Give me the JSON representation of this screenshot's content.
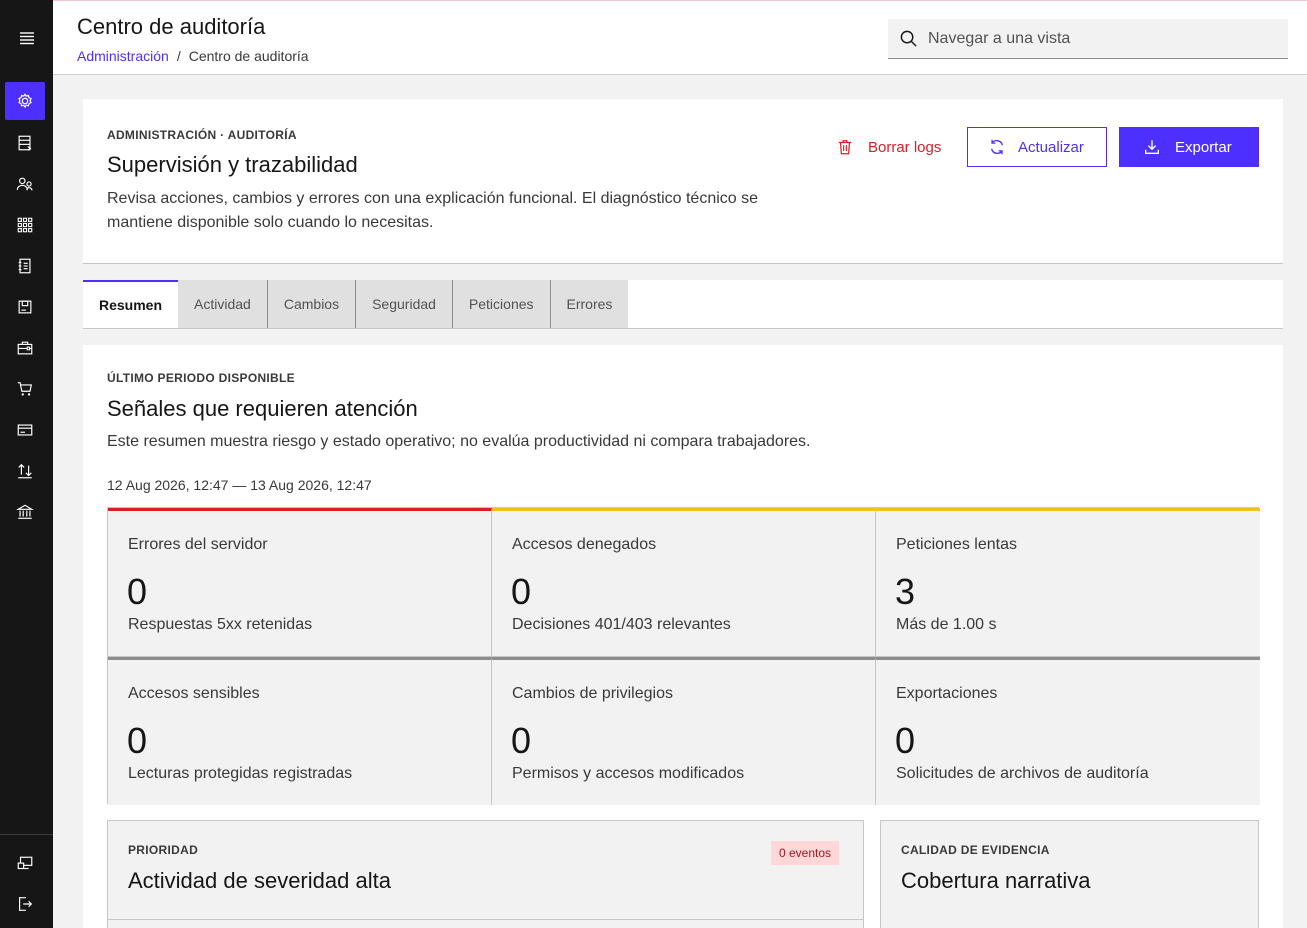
{
  "header": {
    "title": "Centro de auditoría",
    "breadcrumb": {
      "parent": "Administración",
      "separator": "/",
      "current": "Centro de auditoría"
    },
    "search_placeholder": "Navegar a una vista"
  },
  "sidebar": {
    "items": [
      {
        "name": "settings",
        "icon": "gear-icon",
        "active": true
      },
      {
        "name": "data-catalog",
        "icon": "data-icon"
      },
      {
        "name": "users",
        "icon": "user-group-icon"
      },
      {
        "name": "apps",
        "icon": "grid-icon"
      },
      {
        "name": "ledger",
        "icon": "notebook-icon"
      },
      {
        "name": "inventory",
        "icon": "box-icon"
      },
      {
        "name": "business",
        "icon": "briefcase-icon"
      },
      {
        "name": "cart",
        "icon": "cart-icon"
      },
      {
        "name": "payments",
        "icon": "credit-card-icon"
      },
      {
        "name": "transfers",
        "icon": "arrows-icon"
      },
      {
        "name": "bank",
        "icon": "bank-icon"
      }
    ],
    "bottom": [
      {
        "name": "switch-view",
        "icon": "screen-icon"
      },
      {
        "name": "logout",
        "icon": "logout-icon"
      }
    ]
  },
  "intro": {
    "eyebrow": "ADMINISTRACIÓN · AUDITORÍA",
    "title": "Supervisión y trazabilidad",
    "description": "Revisa acciones, cambios y errores con una explicación funcional. El diagnóstico técnico se mantiene disponible solo cuando lo necesitas.",
    "actions": {
      "clear": "Borrar logs",
      "refresh": "Actualizar",
      "export": "Exportar"
    }
  },
  "tabs": [
    "Resumen",
    "Actividad",
    "Cambios",
    "Seguridad",
    "Peticiones",
    "Errores"
  ],
  "summary": {
    "eyebrow": "ÚLTIMO PERIODO DISPONIBLE",
    "title": "Señales que requieren atención",
    "description": "Este resumen muestra riesgo y estado operativo; no evalúa productividad ni compara trabajadores.",
    "range": "12 Aug 2026, 12:47 — 13 Aug 2026, 12:47",
    "metrics": [
      {
        "label": "Errores del servidor",
        "value": "0",
        "sub": "Respuestas 5xx retenidas",
        "accent": "#da1e28"
      },
      {
        "label": "Accesos denegados",
        "value": "0",
        "sub": "Decisiones 401/403 relevantes",
        "accent": "#f1c21b"
      },
      {
        "label": "Peticiones lentas",
        "value": "3",
        "sub": "Más de 1.00 s",
        "accent": "#f1c21b"
      },
      {
        "label": "Accesos sensibles",
        "value": "0",
        "sub": "Lecturas protegidas registradas",
        "accent": "#8d8d8d"
      },
      {
        "label": "Cambios de privilegios",
        "value": "0",
        "sub": "Permisos y accesos modificados",
        "accent": "#8d8d8d"
      },
      {
        "label": "Exportaciones",
        "value": "0",
        "sub": "Solicitudes de archivos de auditoría",
        "accent": "#8d8d8d"
      }
    ]
  },
  "priority": {
    "eyebrow": "PRIORIDAD",
    "title": "Actividad de severidad alta",
    "tag": "0 eventos"
  },
  "evidence": {
    "eyebrow": "CALIDAD DE EVIDENCIA",
    "title": "Cobertura narrativa"
  },
  "colors": {
    "accent": "#4d30ff",
    "danger": "#da1e28",
    "warning": "#f1c21b",
    "sidebar": "#161616"
  }
}
